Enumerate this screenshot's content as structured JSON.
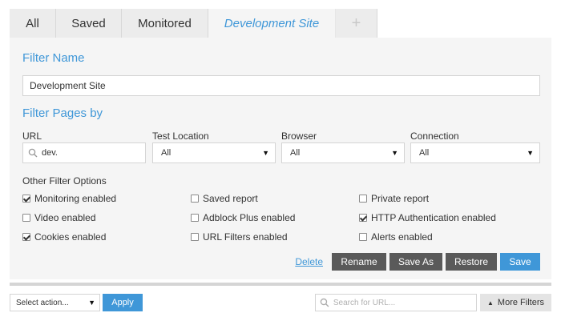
{
  "tabs": [
    {
      "label": "All"
    },
    {
      "label": "Saved"
    },
    {
      "label": "Monitored"
    },
    {
      "label": "Development Site",
      "active": true
    },
    {
      "label": "+"
    }
  ],
  "filter_name": {
    "title": "Filter Name",
    "value": "Development Site"
  },
  "filter_pages": {
    "title": "Filter Pages by",
    "url": {
      "label": "URL",
      "value": "dev."
    },
    "test_location": {
      "label": "Test Location",
      "selected": "All"
    },
    "browser": {
      "label": "Browser",
      "selected": "All"
    },
    "connection": {
      "label": "Connection",
      "selected": "All"
    }
  },
  "other_options": {
    "title": "Other Filter Options",
    "items": [
      {
        "label": "Monitoring enabled",
        "checked": true
      },
      {
        "label": "Saved report",
        "checked": false
      },
      {
        "label": "Private report",
        "checked": false
      },
      {
        "label": "Video enabled",
        "checked": false
      },
      {
        "label": "Adblock Plus enabled",
        "checked": false
      },
      {
        "label": "HTTP Authentication enabled",
        "checked": true
      },
      {
        "label": "Cookies enabled",
        "checked": true
      },
      {
        "label": "URL Filters enabled",
        "checked": false
      },
      {
        "label": "Alerts enabled",
        "checked": false
      }
    ]
  },
  "actions": {
    "delete": "Delete",
    "rename": "Rename",
    "save_as": "Save As",
    "restore": "Restore",
    "save": "Save"
  },
  "bottom_bar": {
    "select_action": "Select action...",
    "apply": "Apply",
    "search_placeholder": "Search for URL...",
    "more_filters": "More Filters"
  },
  "colors": {
    "accent": "#3f97d8",
    "dark_button": "#5a5a5a",
    "panel_bg": "#f5f5f5",
    "tab_bg": "#ececec"
  },
  "icons": {
    "search": "search-icon",
    "dropdown": "caret-down-icon",
    "add_tab": "plus-icon",
    "more": "chevron-up-icon"
  }
}
